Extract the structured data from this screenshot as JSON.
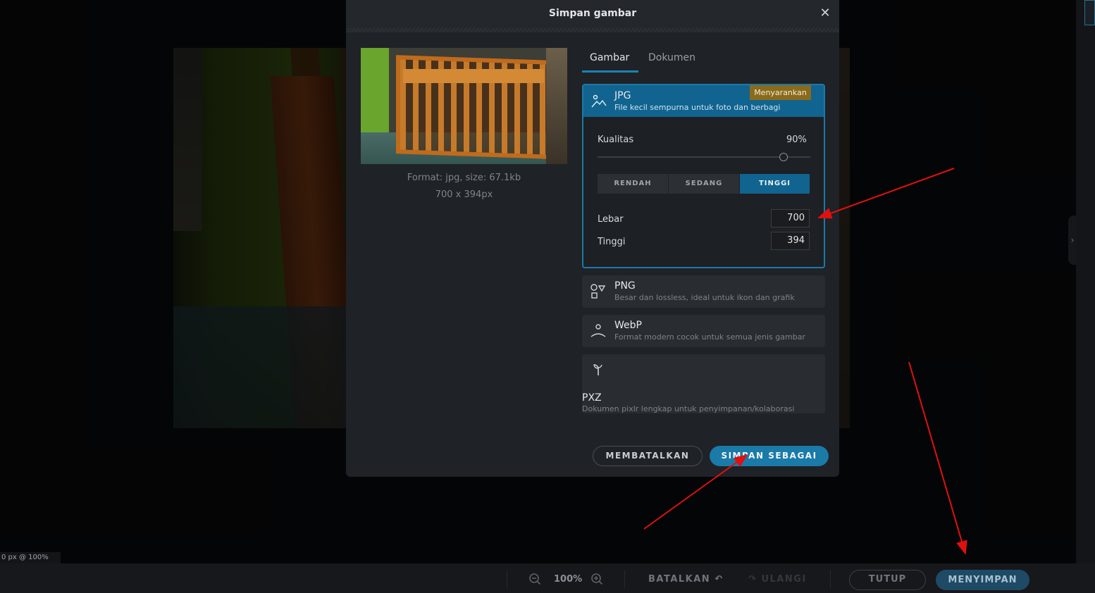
{
  "dialog": {
    "title": "Simpan gambar",
    "close_icon": "close-icon",
    "preview": {
      "format_info": "Format: jpg, size: 67.1kb",
      "dimensions": "700 x 394px"
    },
    "tabs": [
      {
        "label": "Gambar",
        "active": true
      },
      {
        "label": "Dokumen",
        "active": false
      }
    ],
    "formats": {
      "jpg": {
        "name": "JPG",
        "description": "File kecil sempurna untuk foto dan berbagi",
        "badge": "Menyarankan",
        "icon": "landscape-icon",
        "quality_label": "Kualitas",
        "quality_value": "90%",
        "quality_fraction": 0.9,
        "presets": [
          "RENDAH",
          "SEDANG",
          "TINGGI"
        ],
        "active_preset": "TINGGI",
        "width_label": "Lebar",
        "width_value": "700",
        "height_label": "Tinggi",
        "height_value": "394"
      },
      "png": {
        "name": "PNG",
        "description": "Besar dan lossless, ideal untuk ikon dan grafik",
        "icon": "shapes-icon"
      },
      "webp": {
        "name": "WebP",
        "description": "Format modern cocok untuk semua jenis gambar",
        "icon": "user-icon"
      },
      "pxz": {
        "name": "PXZ",
        "description": "Dokumen pixlr lengkap untuk penyimpanan/kolaborasi",
        "icon": "sprout-icon"
      }
    },
    "buttons": {
      "cancel": "MEMBATALKAN",
      "save_as": "SIMPAN SEBAGAI"
    }
  },
  "status": {
    "text": "0 px @ 100%"
  },
  "toolbar": {
    "zoom": "100%",
    "undo": "BATALKAN",
    "redo": "ULANGI",
    "close": "TUTUP",
    "save": "MENYIMPAN"
  },
  "colors": {
    "accent": "#1a7aa8",
    "badge": "#8a6a1c",
    "annotation_arrow": "#e01010"
  }
}
